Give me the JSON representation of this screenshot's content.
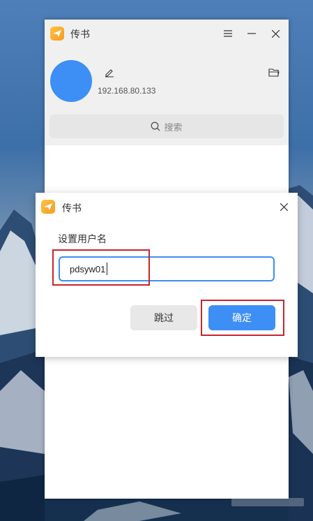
{
  "main_window": {
    "title": "传书",
    "ip": "192.168.80.133",
    "search_placeholder": "搜索",
    "controls": [
      "menu-icon",
      "minimize-icon",
      "close-icon"
    ]
  },
  "dialog": {
    "title": "传书",
    "label": "设置用户名",
    "username_value": "pdsyw01",
    "skip_label": "跳过",
    "confirm_label": "确定"
  },
  "colors": {
    "accent": "#3d8ef5",
    "highlight": "#c8252c",
    "logo": "#f5a623"
  }
}
